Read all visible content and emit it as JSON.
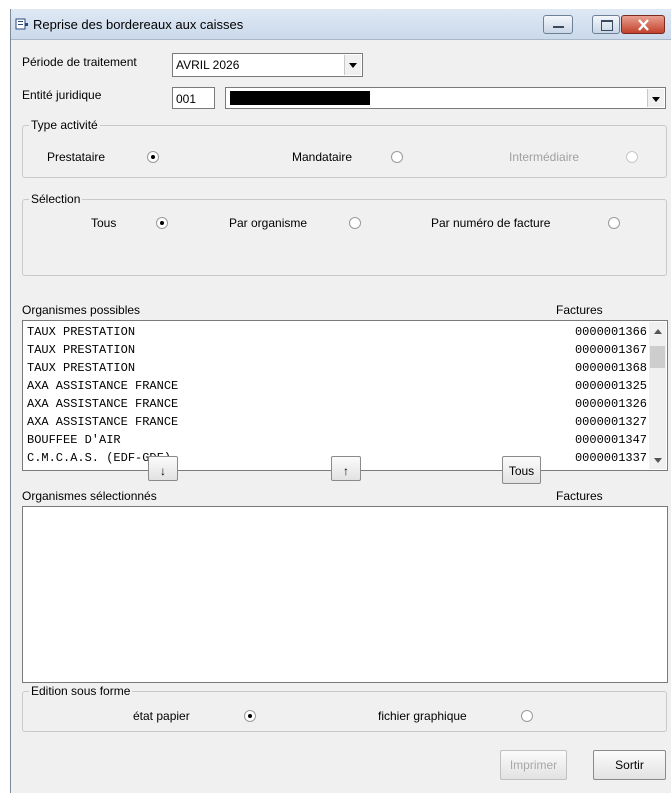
{
  "window": {
    "title": "Reprise des bordereaux aux caisses"
  },
  "periode": {
    "label": "Période de traitement",
    "value": "AVRIL 2026"
  },
  "entite": {
    "label": "Entité juridique",
    "code": "001",
    "name": ""
  },
  "type_activite": {
    "legend": "Type activité",
    "options": [
      {
        "label": "Prestataire",
        "selected": true,
        "enabled": true
      },
      {
        "label": "Mandataire",
        "selected": false,
        "enabled": true
      },
      {
        "label": "Intermédiaire",
        "selected": false,
        "enabled": false
      }
    ]
  },
  "selection": {
    "legend": "Sélection",
    "options": [
      {
        "label": "Tous",
        "selected": true
      },
      {
        "label": "Par organisme",
        "selected": false
      },
      {
        "label": "Par numéro de facture",
        "selected": false
      }
    ]
  },
  "possibles": {
    "header": "Organismes possibles",
    "factures_header": "Factures",
    "rows": [
      {
        "name": "TAUX PRESTATION",
        "facture": "0000001366"
      },
      {
        "name": "TAUX PRESTATION",
        "facture": "0000001367"
      },
      {
        "name": "TAUX PRESTATION",
        "facture": "0000001368"
      },
      {
        "name": "AXA ASSISTANCE FRANCE",
        "facture": "0000001325"
      },
      {
        "name": "AXA ASSISTANCE FRANCE",
        "facture": "0000001326"
      },
      {
        "name": "AXA ASSISTANCE FRANCE",
        "facture": "0000001327"
      },
      {
        "name": "BOUFFEE D'AIR",
        "facture": "0000001347"
      },
      {
        "name": "C.M.C.A.S. (EDF-GDF)",
        "facture": "0000001337"
      }
    ]
  },
  "move_buttons": {
    "down": "↓",
    "up": "↑",
    "all": "Tous"
  },
  "selectionnes": {
    "header": "Organismes sélectionnés",
    "factures_header": "Factures"
  },
  "edition": {
    "legend": "Edition sous forme",
    "options": [
      {
        "label": "état papier",
        "selected": true
      },
      {
        "label": "fichier graphique",
        "selected": false
      }
    ]
  },
  "footer": {
    "print_label": "Imprimer",
    "exit_label": "Sortir"
  },
  "colors": {
    "titlebar": "#cbd9ea",
    "window_bg": "#f0f0f0",
    "close_button": "#c2412b"
  }
}
